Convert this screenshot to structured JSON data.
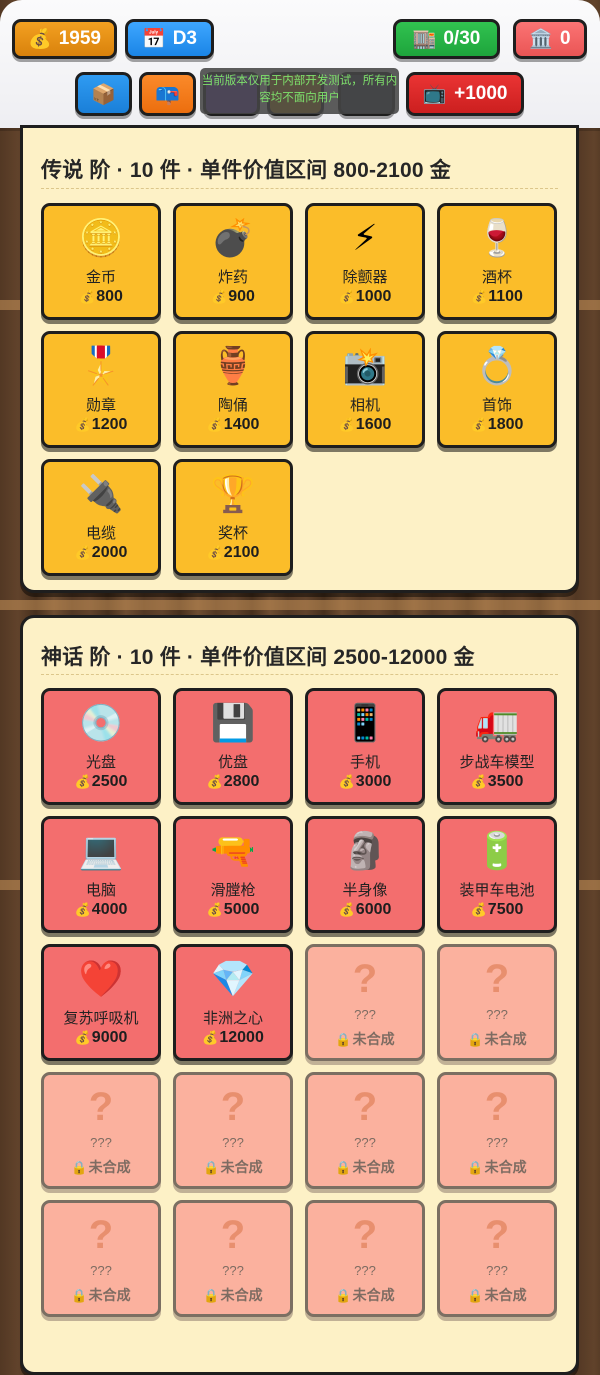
{
  "header": {
    "gold": "1959",
    "day": "D3",
    "capacity": "0/30",
    "bank": "0",
    "ad_reward": "+1000",
    "notice": "当前版本仅用于内部开发测试，所有内容均不面向用户",
    "icons": {
      "gold": "💰",
      "day": "📅",
      "capacity": "🏬",
      "bank": "🏛️",
      "box": "📦",
      "mail": "📪",
      "tv": "📺"
    }
  },
  "panels": [
    {
      "title": "传说 阶 · 10 件 · 单件价值区间 800-2100 金",
      "tier": "legend",
      "items": [
        {
          "icon": "🪙",
          "name": "金币",
          "price": "800"
        },
        {
          "icon": "💣",
          "name": "炸药",
          "price": "900"
        },
        {
          "icon": "⚡",
          "name": "除颤器",
          "price": "1000"
        },
        {
          "icon": "🍷",
          "name": "酒杯",
          "price": "1100"
        },
        {
          "icon": "🎖️",
          "name": "勋章",
          "price": "1200"
        },
        {
          "icon": "🏺",
          "name": "陶俑",
          "price": "1400"
        },
        {
          "icon": "📸",
          "name": "相机",
          "price": "1600"
        },
        {
          "icon": "💍",
          "name": "首饰",
          "price": "1800"
        },
        {
          "icon": "🔌",
          "name": "电缆",
          "price": "2000"
        },
        {
          "icon": "🏆",
          "name": "奖杯",
          "price": "2100"
        }
      ]
    },
    {
      "title": "神话 阶 · 10 件 · 单件价值区间 2500-12000 金",
      "tier": "myth",
      "items": [
        {
          "icon": "💿",
          "name": "光盘",
          "price": "2500"
        },
        {
          "icon": "💾",
          "name": "优盘",
          "price": "2800"
        },
        {
          "icon": "📱",
          "name": "手机",
          "price": "3000"
        },
        {
          "icon": "🚛",
          "name": "步战车模型",
          "price": "3500"
        },
        {
          "icon": "💻",
          "name": "电脑",
          "price": "4000"
        },
        {
          "icon": "🔫",
          "name": "滑膛枪",
          "price": "5000"
        },
        {
          "icon": "🗿",
          "name": "半身像",
          "price": "6000"
        },
        {
          "icon": "🔋",
          "name": "装甲车电池",
          "price": "7500"
        },
        {
          "icon": "❤️",
          "name": "复苏呼吸机",
          "price": "9000"
        },
        {
          "icon": "💎",
          "name": "非洲之心",
          "price": "12000"
        }
      ],
      "locked_count": 10,
      "locked": {
        "icon": "?",
        "name": "???",
        "status": "未合成",
        "lock_icon": "🔒"
      }
    }
  ],
  "coin_icon": "💰"
}
